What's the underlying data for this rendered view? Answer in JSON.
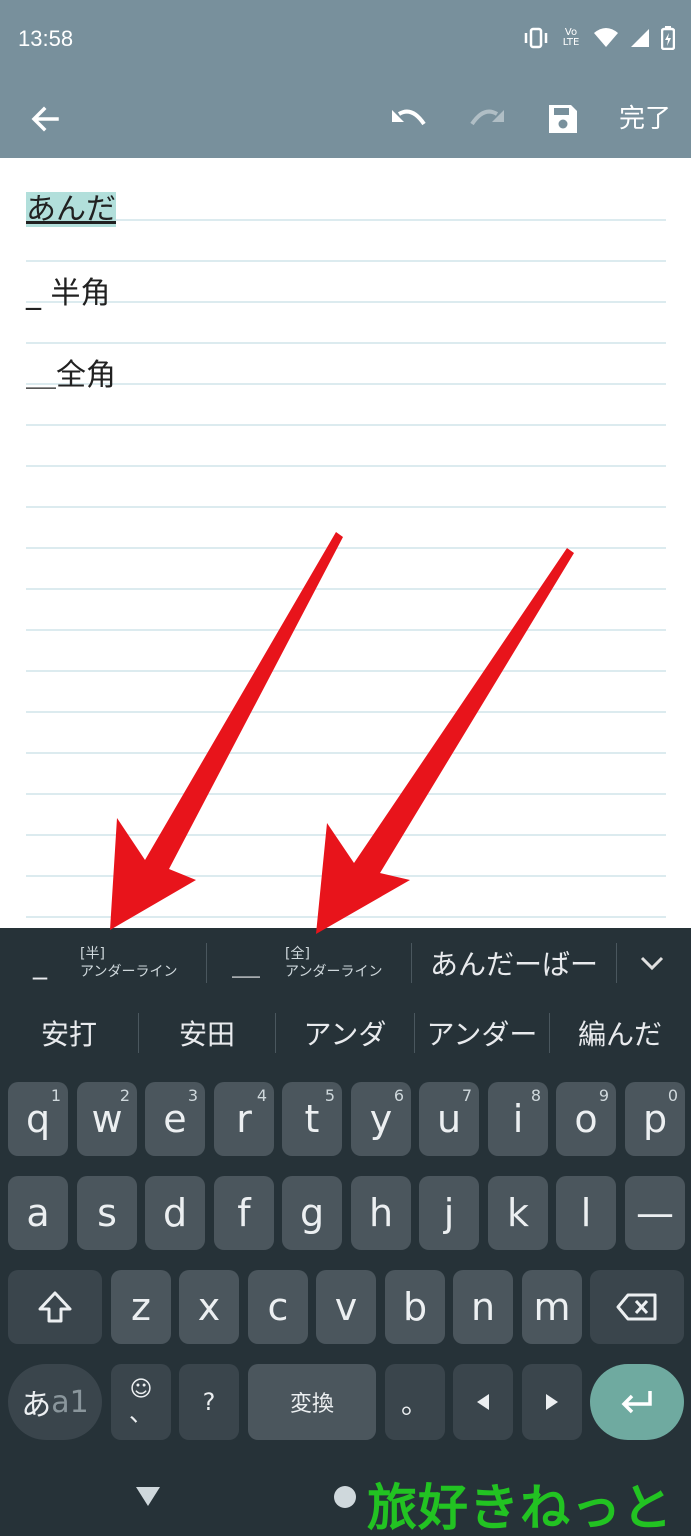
{
  "status": {
    "time": "13:58",
    "icons": [
      "vibrate-icon",
      "volte-icon",
      "wifi-icon",
      "signal-icon",
      "battery-icon"
    ],
    "volte_label": "Vo LTE"
  },
  "toolbar": {
    "done_label": "完了"
  },
  "editor": {
    "lines": [
      {
        "text": "あんだ",
        "composing": true
      },
      {
        "text": "_ 半角"
      },
      {
        "text": "＿全角"
      }
    ]
  },
  "keyboard": {
    "candidates_row1": [
      {
        "text": "_",
        "style": "big"
      },
      {
        "tag": "[半]",
        "sub": "アンダーライン"
      },
      {
        "text": "＿",
        "style": "big"
      },
      {
        "tag": "[全]",
        "sub": "アンダーライン"
      },
      {
        "text": "あんだーばー",
        "style": "med"
      }
    ],
    "candidates_row2": [
      "安打",
      "安田",
      "アンダ",
      "アンダー",
      "編んだ"
    ],
    "row1": [
      {
        "k": "q",
        "h": "1"
      },
      {
        "k": "w",
        "h": "2"
      },
      {
        "k": "e",
        "h": "3"
      },
      {
        "k": "r",
        "h": "4"
      },
      {
        "k": "t",
        "h": "5"
      },
      {
        "k": "y",
        "h": "6"
      },
      {
        "k": "u",
        "h": "7"
      },
      {
        "k": "i",
        "h": "8"
      },
      {
        "k": "o",
        "h": "9"
      },
      {
        "k": "p",
        "h": "0"
      }
    ],
    "row2": [
      "a",
      "s",
      "d",
      "f",
      "g",
      "h",
      "j",
      "k",
      "l",
      "—"
    ],
    "row3": [
      "z",
      "x",
      "c",
      "v",
      "b",
      "n",
      "m"
    ],
    "mode_label_a": "あ",
    "mode_label_b": "a1",
    "emoji_label": "☺",
    "comma_label": "、",
    "question_label": "?",
    "convert_label": "変換",
    "period_label": "。"
  },
  "watermark": "旅好きねっと",
  "colors": {
    "header": "#78909c",
    "keyboard_bg": "#263238",
    "key": "#4b565d",
    "enter": "#6faaa0",
    "arrow": "#e8141b",
    "watermark": "#22c322"
  }
}
